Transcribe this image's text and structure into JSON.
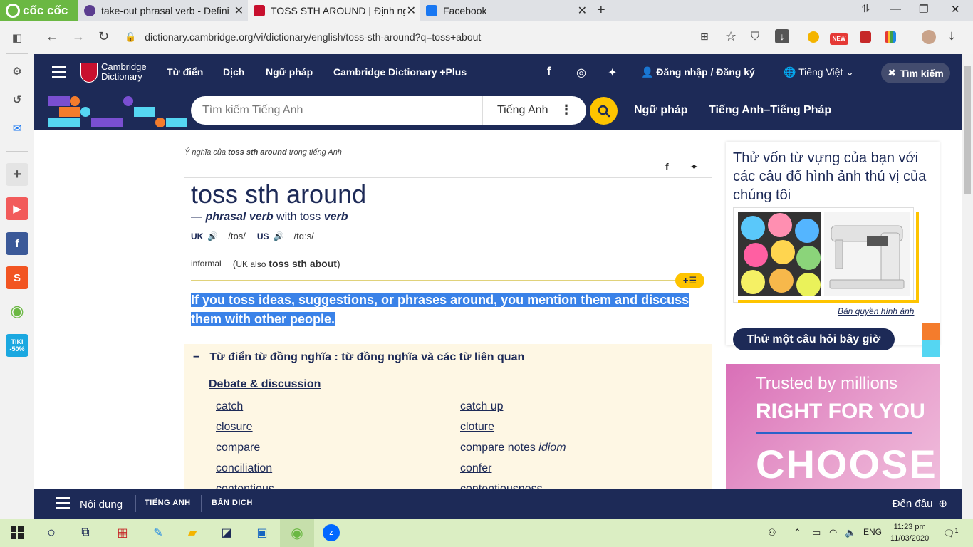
{
  "browser": {
    "brand": "cốc cốc",
    "tabs": [
      {
        "title": "take-out phrasal verb - Defini",
        "favicon_color": "#5b3d8f"
      },
      {
        "title": "TOSS STH AROUND | Định ng",
        "favicon_color": "#c8102e"
      },
      {
        "title": "Facebook",
        "favicon_color": "#1877f2"
      }
    ],
    "url": "dictionary.cambridge.org/vi/dictionary/english/toss-sth-around?q=toss+about",
    "new_badge": "NEW",
    "sidebar_badge": "TIKI -50%"
  },
  "site": {
    "logo_line1": "Cambridge",
    "logo_line2": "Dictionary",
    "nav": [
      "Từ điển",
      "Dịch",
      "Ngữ pháp",
      "Cambridge Dictionary +Plus"
    ],
    "login": "Đăng nhập / Đăng ký",
    "language": "Tiếng Việt",
    "search_toggle": "Tìm kiếm",
    "search_placeholder": "Tìm kiếm Tiếng Anh",
    "search_lang": "Tiếng Anh",
    "band_links": [
      "Ngữ pháp",
      "Tiếng Anh–Tiếng Pháp"
    ]
  },
  "entry": {
    "breadcrumb_pre": "Ý nghĩa của ",
    "breadcrumb_word": "toss sth around",
    "breadcrumb_post": " trong tiếng Anh",
    "headword": "toss sth around",
    "pos_dash": "— ",
    "pos": "phrasal verb",
    "pos_with": " with toss ",
    "pos_base": "verb",
    "uk_label": "UK",
    "uk_ipa": "/tɒs/",
    "us_label": "US",
    "us_ipa": "/tɑːs/",
    "register": "informal",
    "variant_label": "UK also",
    "variant_word": "toss sth about",
    "definition": "If you toss ideas, suggestions, or phrases around, you mention them and discuss them with other people."
  },
  "thesaurus": {
    "heading": "Từ điển từ đồng nghĩa : từ đồng nghĩa và các từ liên quan",
    "category": "Debate & discussion",
    "left": [
      "catch",
      "closure",
      "compare",
      "conciliation",
      "contentious"
    ],
    "right": [
      "catch up",
      "cloture",
      "compare notes",
      "confer",
      "contentiousness"
    ],
    "idiom_label": "idiom"
  },
  "quiz": {
    "title": "Thử vốn từ vựng của bạn với các câu đố hình ảnh thú vị của chúng tôi",
    "credit": "Bản quyền hình ảnh",
    "button": "Thử một câu hỏi bây giờ"
  },
  "ad": {
    "line1": "Trusted by millions",
    "line2": "RIGHT FOR YOU",
    "line3": "CHOOSE"
  },
  "bottom_bar": {
    "toc": "Nội dung",
    "tab1": "TIẾNG ANH",
    "tab2": "BẢN DỊCH",
    "top": "Đến đầu"
  },
  "taskbar": {
    "lang": "ENG",
    "time": "11:23 pm",
    "date": "11/03/2020",
    "notif_count": "1"
  },
  "colors": {
    "navy": "#1d2a57",
    "yellow": "#fec400",
    "highlight": "#3a82e8",
    "thesaurus_bg": "#fef7e4"
  }
}
